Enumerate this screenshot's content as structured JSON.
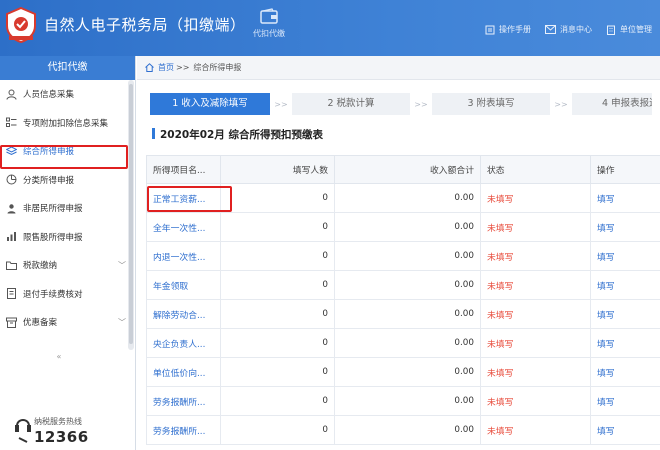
{
  "header": {
    "title": "自然人电子税务局（扣缴端）",
    "nav_label": "代扣代缴",
    "links": [
      "操作手册",
      "消息中心",
      "单位管理"
    ]
  },
  "sidebar": {
    "heading": "代扣代缴",
    "items": [
      {
        "label": "人员信息采集",
        "icon": "person-icon"
      },
      {
        "label": "专项附加扣除信息采集",
        "icon": "list-icon"
      },
      {
        "label": "综合所得申报",
        "icon": "layers-icon",
        "active": true
      },
      {
        "label": "分类所得申报",
        "icon": "pie-icon"
      },
      {
        "label": "非居民所得申报",
        "icon": "user-icon"
      },
      {
        "label": "限售股所得申报",
        "icon": "bar-chart-icon"
      },
      {
        "label": "税款缴纳",
        "icon": "folder-icon",
        "expandable": true
      },
      {
        "label": "退付手续费核对",
        "icon": "document-icon"
      },
      {
        "label": "优惠备案",
        "icon": "archive-icon",
        "expandable": true
      }
    ],
    "collapse_glyph": "«",
    "hotline_label": "纳税服务热线",
    "hotline_number": "12366"
  },
  "breadcrumb": {
    "home": "首页",
    "separator": ">>",
    "current": "综合所得申报"
  },
  "steps": [
    "1 收入及减除填写",
    "2 税款计算",
    "3 附表填写",
    "4 申报表报送"
  ],
  "period_title": "2020年02月  综合所得预扣预缴表",
  "table": {
    "headers": [
      "所得项目名...",
      "填写人数",
      "收入额合计",
      "状态",
      "操作"
    ],
    "rows": [
      [
        "正常工资薪...",
        "0",
        "0.00",
        "未填写",
        "填写"
      ],
      [
        "全年一次性...",
        "0",
        "0.00",
        "未填写",
        "填写"
      ],
      [
        "内退一次性...",
        "0",
        "0.00",
        "未填写",
        "填写"
      ],
      [
        "年金领取",
        "0",
        "0.00",
        "未填写",
        "填写"
      ],
      [
        "解除劳动合...",
        "0",
        "0.00",
        "未填写",
        "填写"
      ],
      [
        "央企负责人...",
        "0",
        "0.00",
        "未填写",
        "填写"
      ],
      [
        "单位低价向...",
        "0",
        "0.00",
        "未填写",
        "填写"
      ],
      [
        "劳务报酬所...",
        "0",
        "0.00",
        "未填写",
        "填写"
      ],
      [
        "劳务报酬所...",
        "0",
        "0.00",
        "未填写",
        "填写"
      ]
    ]
  },
  "colors": {
    "brand": "#3a7dd3",
    "link": "#2f6fcf",
    "status_unfilled": "#e84a3a",
    "highlight": "#e02020"
  }
}
